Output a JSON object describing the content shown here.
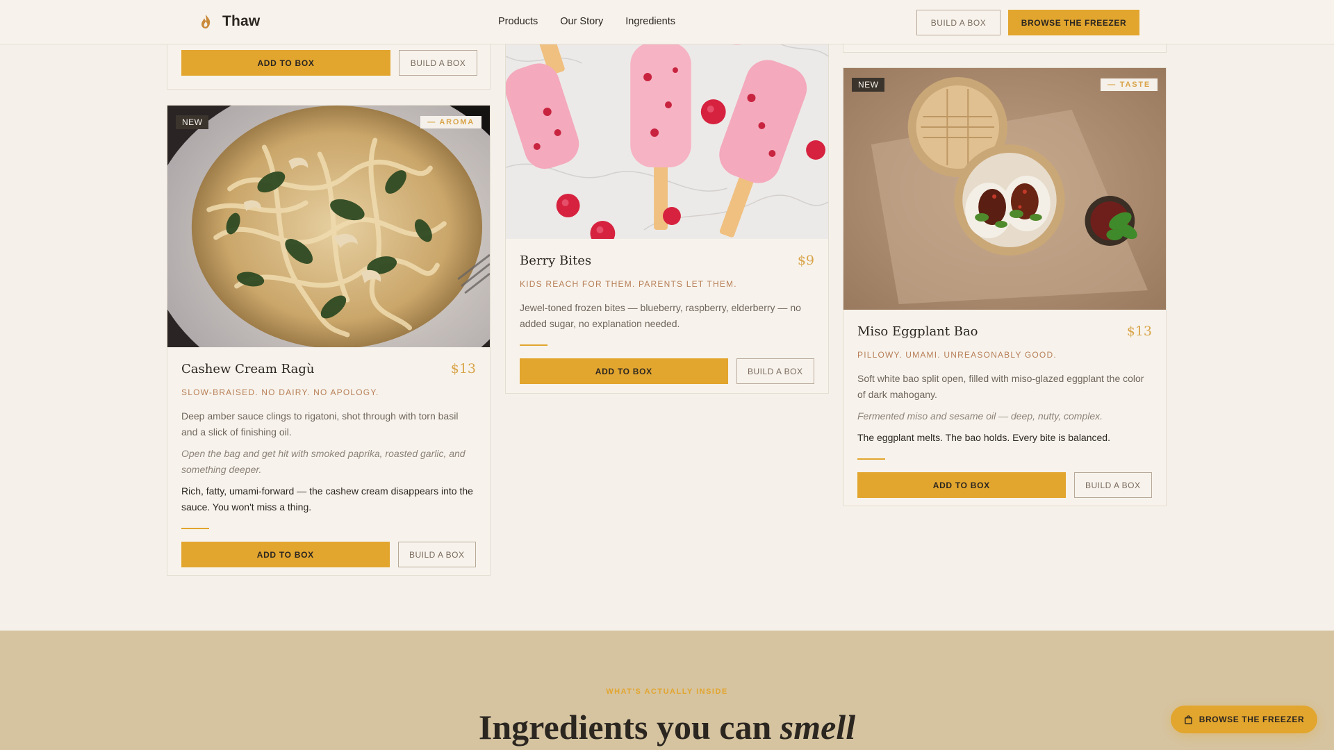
{
  "header": {
    "brand": "Thaw",
    "nav": [
      "Products",
      "Our Story",
      "Ingredients"
    ],
    "build_box_label": "BUILD A BOX",
    "browse_label": "BROWSE THE FREEZER"
  },
  "buttons": {
    "add_to_box": "ADD TO BOX",
    "build_a_box": "BUILD A BOX"
  },
  "cards": {
    "cashew": {
      "badge": "NEW",
      "tag": "— AROMA",
      "title": "Cashew Cream Ragù",
      "price": "$13",
      "tagline": "SLOW-BRAISED. NO DAIRY. NO APOLOGY.",
      "description": "Deep amber sauce clings to rigatoni, shot through with torn basil and a slick of finishing oil.",
      "aroma_note": "Open the bag and get hit with smoked paprika, roasted garlic, and something deeper.",
      "highlight": "Rich, fatty, umami-forward — the cashew cream disappears into the sauce. You won't miss a thing."
    },
    "berry": {
      "title": "Berry Bites",
      "price": "$9",
      "tagline": "KIDS REACH FOR THEM. PARENTS LET THEM.",
      "description": "Jewel-toned frozen bites — blueberry, raspberry, elderberry — no added sugar, no explanation needed."
    },
    "bao": {
      "badge": "NEW",
      "tag": "— TASTE",
      "title": "Miso Eggplant Bao",
      "price": "$13",
      "tagline": "PILLOWY. UMAMI. UNREASONABLY GOOD.",
      "description": "Soft white bao split open, filled with miso-glazed eggplant the color of dark mahogany.",
      "taste_note": "Fermented miso and sesame oil — deep, nutty, complex.",
      "highlight": "The eggplant melts. The bao holds. Every bite is balanced."
    }
  },
  "ingredients_section": {
    "eyebrow": "WHAT'S ACTUALLY INSIDE",
    "headline_start": "Ingredients you can ",
    "headline_emphasis": "smell"
  },
  "floating_cta": {
    "label": "BROWSE THE FREEZER",
    "icon": "shopping-bag-icon"
  },
  "colors": {
    "accent": "#e2a52e",
    "background": "#f5f1ea",
    "section": "#d6c4a1"
  }
}
